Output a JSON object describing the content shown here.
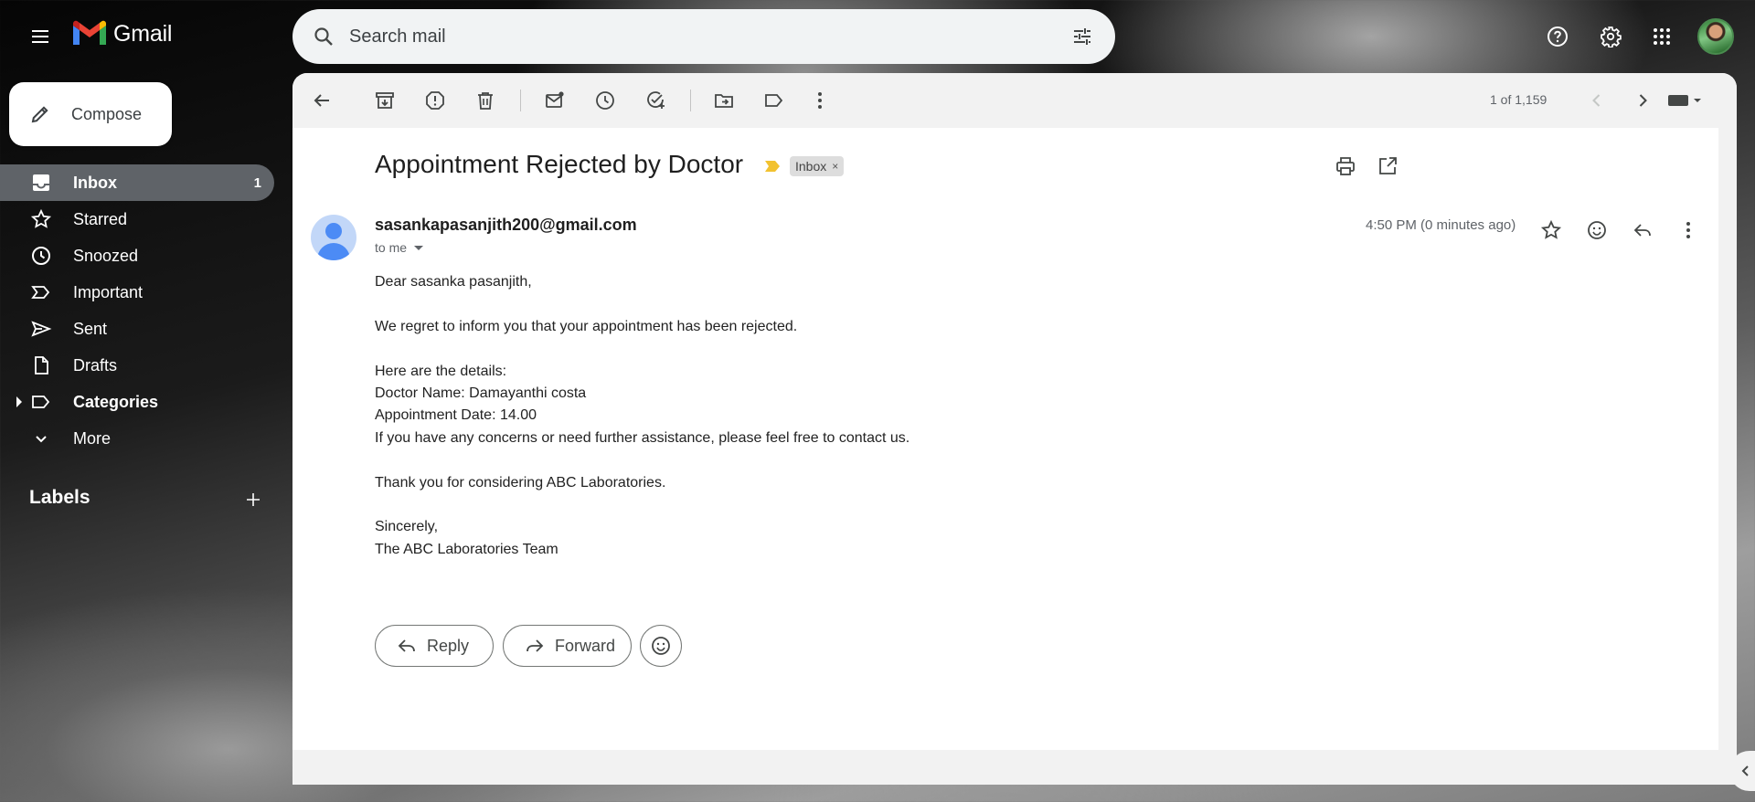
{
  "header": {
    "app_name": "Gmail",
    "search_placeholder": "Search mail",
    "icons": [
      "main-menu-icon",
      "gmail-logo",
      "search-icon",
      "search-options-icon",
      "help-icon",
      "settings-icon",
      "apps-icon",
      "account-avatar"
    ]
  },
  "sidebar": {
    "compose_label": "Compose",
    "items": [
      {
        "label": "Inbox",
        "count": "1",
        "icon": "inbox-icon",
        "active": true
      },
      {
        "label": "Starred",
        "count": "",
        "icon": "star-icon"
      },
      {
        "label": "Snoozed",
        "count": "",
        "icon": "clock-icon"
      },
      {
        "label": "Important",
        "count": "",
        "icon": "important-icon"
      },
      {
        "label": "Sent",
        "count": "",
        "icon": "send-icon"
      },
      {
        "label": "Drafts",
        "count": "",
        "icon": "draft-icon"
      },
      {
        "label": "Categories",
        "count": "",
        "icon": "label-icon"
      },
      {
        "label": "More",
        "count": "",
        "icon": "chevron-down-icon"
      }
    ],
    "labels_heading": "Labels"
  },
  "toolbar": {
    "pager_text": "1 of 1,159",
    "icons": [
      "back-icon",
      "archive-icon",
      "report-spam-icon",
      "delete-icon",
      "mark-unread-icon",
      "snooze-icon",
      "add-task-icon",
      "move-to-icon",
      "labels-icon",
      "more-vert-icon",
      "prev-icon",
      "next-icon",
      "input-tools-icon"
    ]
  },
  "email": {
    "subject": "Appointment Rejected by Doctor",
    "label_chip": "Inbox",
    "label_chip_close": "×",
    "sender": "sasankapasanjith200@gmail.com",
    "recipient": "to me",
    "timestamp": "4:50 PM (0 minutes ago)",
    "body": {
      "greeting": "Dear sasanka pasanjith,",
      "line1": "We regret to inform you that your appointment has been rejected.",
      "details_heading": "Here are the details:",
      "doctor": "Doctor Name: Damayanthi costa",
      "date": "Appointment Date: 14.00",
      "contact": "If you have any concerns or need further assistance, please feel free to contact us.",
      "thanks": "Thank you for considering ABC Laboratories.",
      "signoff": "Sincerely,",
      "team": "The ABC Laboratories Team"
    },
    "actions": {
      "reply_label": "Reply",
      "forward_label": "Forward"
    }
  },
  "colors": {
    "active_nav_bg": "#5f6368",
    "important_marker": "#f2c230",
    "panel_bg": "#ffffff",
    "toolbar_bg": "#f2f2f2",
    "avatar_blue": "#4c8bf5"
  }
}
